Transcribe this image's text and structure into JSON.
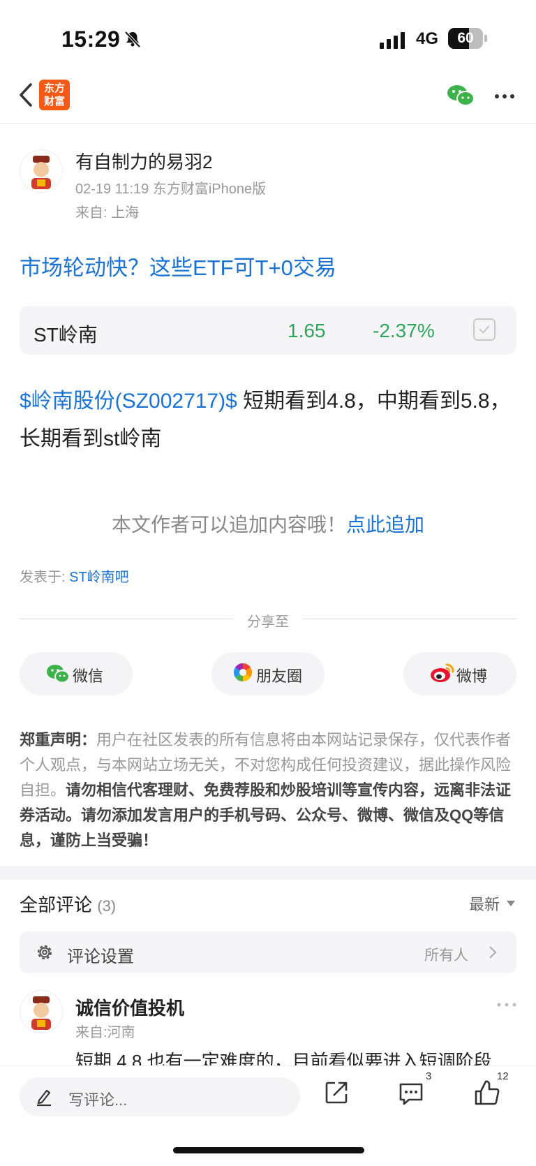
{
  "status_bar": {
    "time": "15:29",
    "network": "4G",
    "battery": "60",
    "battery_level": 0.6
  },
  "nav": {
    "logo_line1": "东方",
    "logo_line2": "财富"
  },
  "post": {
    "author": "有自制力的易羽2",
    "meta": "02-19 11:19 东方财富iPhone版",
    "location": "来自: 上海",
    "title": "市场轮动快？这些ETF可T+0交易",
    "stock_card": {
      "name": "ST岭南",
      "price": "1.65",
      "change": "-2.37%"
    },
    "stock_link": "$岭南股份(SZ002717)$",
    "body_rest": "  短期看到4.8，中期看到5.8，长期看到st岭南",
    "append_prompt": "本文作者可以追加内容哦！",
    "append_link": "点此追加",
    "posted_in_label": "发表于: ",
    "posted_in_bar": "ST岭南吧"
  },
  "share": {
    "label": "分享至",
    "wechat": "微信",
    "moments": "朋友圈",
    "weibo": "微博"
  },
  "disclaimer": {
    "lead": "郑重声明：",
    "normal": "用户在社区发表的所有信息将由本网站记录保存，仅代表作者个人观点，与本网站立场无关，不对您构成任何投资建议，据此操作风险自担。",
    "bold": "请勿相信代客理财、免费荐股和炒股培训等宣传内容，远离非法证券活动。请勿添加发言用户的手机号码、公众号、微博、微信及QQ等信息，谨防上当受骗！"
  },
  "comments": {
    "title": "全部评论",
    "count": "(3)",
    "sort": "最新",
    "settings_label": "评论设置",
    "settings_value": "所有人",
    "first": {
      "name": "诚信价值投机",
      "location": "来自:河南",
      "text": "短期 4.8 也有一定难度的，目前看似要进入短调阶段"
    }
  },
  "bottom_bar": {
    "placeholder": "写评论...",
    "comment_count": "3",
    "like_count": "12"
  },
  "colors": {
    "link": "#1a73d4",
    "down": "#2fa55d",
    "brand": "#f55a14"
  },
  "icons": [
    "bell-mute-icon",
    "signal-icon",
    "back-icon",
    "wechat-icon",
    "more-icon",
    "checkbox-icon",
    "weibo-icon",
    "moments-icon",
    "gear-icon",
    "chevron-right-icon",
    "pencil-icon",
    "share-out-icon",
    "comments-icon",
    "like-icon"
  ]
}
